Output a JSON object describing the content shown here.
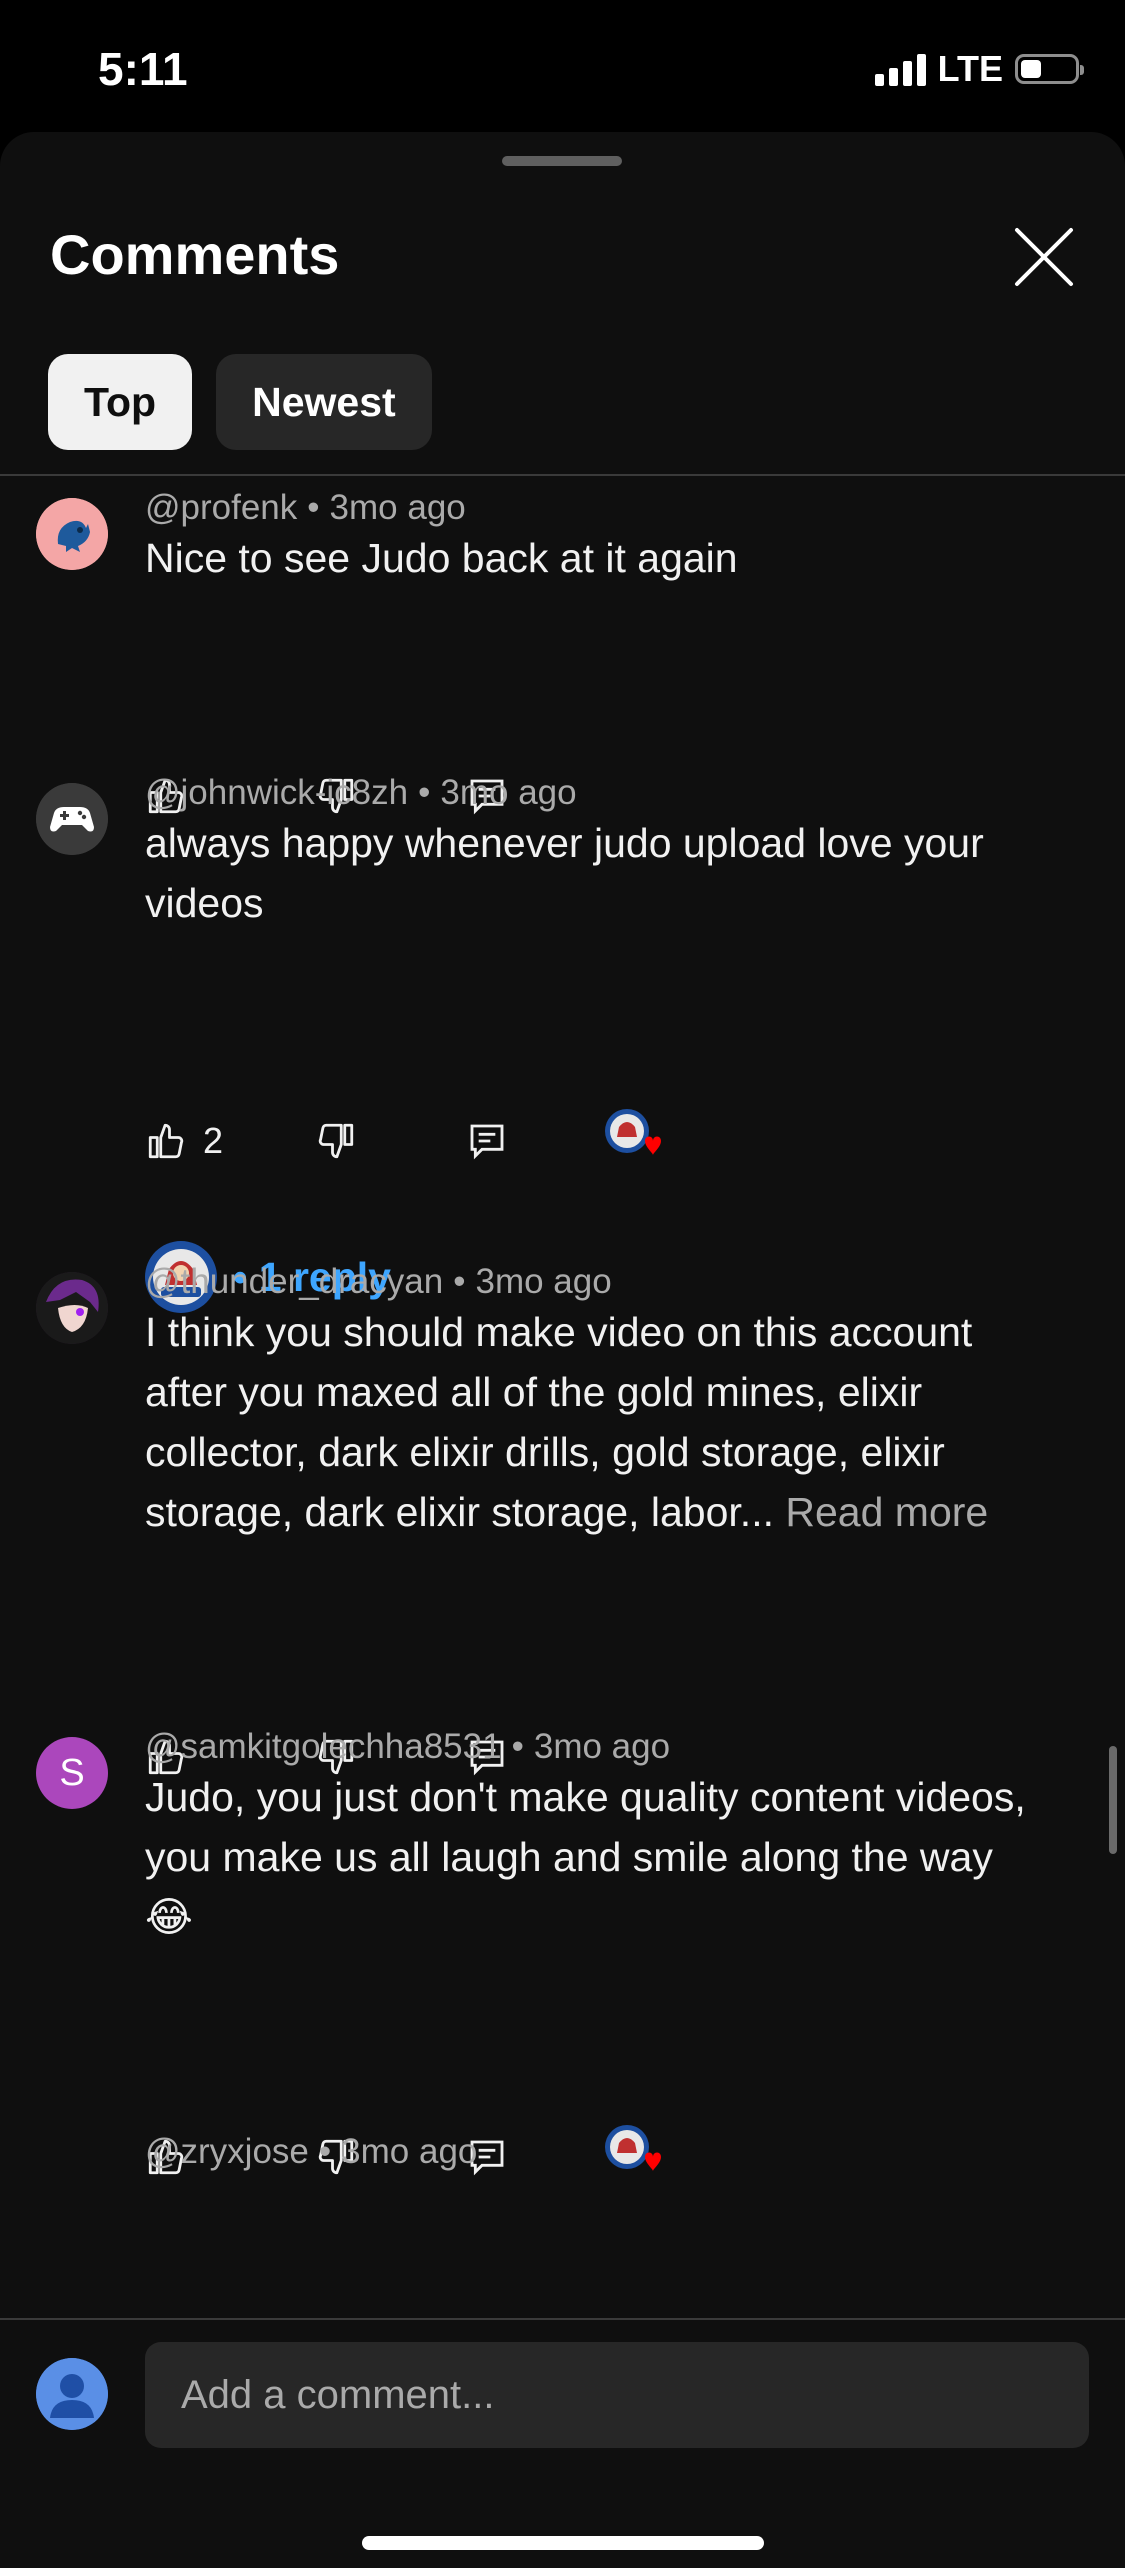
{
  "status_bar": {
    "time": "5:11",
    "network": "LTE",
    "battery_level": 0.35
  },
  "sheet": {
    "title": "Comments",
    "tabs": [
      {
        "label": "Top",
        "active": true
      },
      {
        "label": "Newest",
        "active": false
      }
    ]
  },
  "comments": [
    {
      "author": "@profenk",
      "age": "3mo ago",
      "text": "Nice to see Judo back at it again",
      "likes": "",
      "avatar_icon": "blue-creature-avatar"
    },
    {
      "author": "@johnwick-ic8zh",
      "age": "3mo ago",
      "text": "always happy whenever judo upload love your videos",
      "likes": "2",
      "creator_hearted": true,
      "avatar_icon": "gamepad-avatar",
      "replies_label": "1 reply"
    },
    {
      "author": "@thunder_dracyan",
      "age": "3mo ago",
      "text": "I think you should make video on this account after you maxed all of the gold mines, elixir collector, dark elixir drills, gold storage, elixir storage, dark elixir storage, labor...",
      "read_more": "Read more",
      "likes": "",
      "avatar_icon": "anime-avatar"
    },
    {
      "author": "@samkitgolechha8531",
      "age": "3mo ago",
      "text": "Judo, you just don't make quality content videos, you make us all laugh and smile along the way 😂",
      "likes": "",
      "creator_hearted": true,
      "avatar_letter": "S"
    },
    {
      "author": "@zryxjose",
      "age": "3mo ago"
    }
  ],
  "composer": {
    "placeholder": "Add a comment..."
  },
  "colors": {
    "accent": "#3ea6ff",
    "background": "#0f0f0f",
    "chip": "#272727",
    "heart": "#ff0000"
  }
}
